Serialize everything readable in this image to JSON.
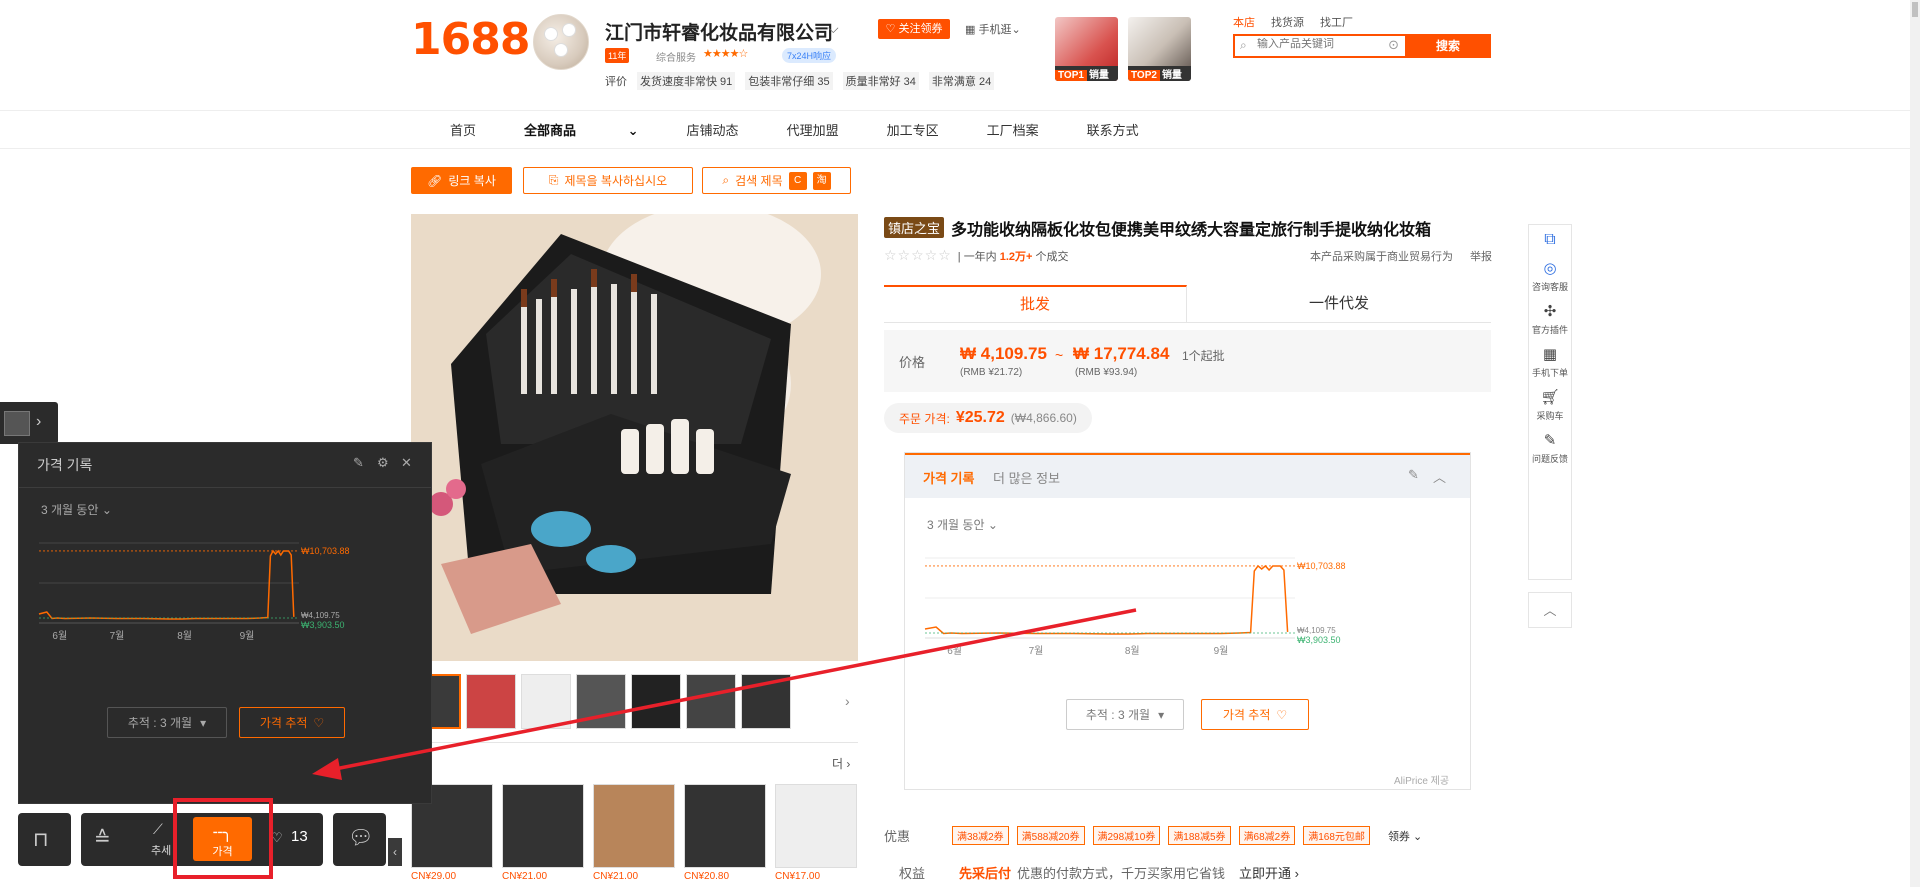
{
  "header": {
    "logo": "1688",
    "shop_name": "江门市轩睿化妆品有限公司",
    "follow_label": "关注领券",
    "mobile_label": "手机逛",
    "year_badge": "11年",
    "service_label": "综合服务",
    "service_stars": "★★★★☆",
    "support_badge": "7x24H响应",
    "rating_label": "评价",
    "ratings": [
      "发货速度非常快 91",
      "包装非常仔细 35",
      "质量非常好 34",
      "非常满意 24"
    ],
    "promos": [
      {
        "rank": "TOP1",
        "label": "销量"
      },
      {
        "rank": "TOP2",
        "label": "销量"
      }
    ],
    "search_tabs": [
      "本店",
      "找货源",
      "找工厂"
    ],
    "search_placeholder": "输入产品关键词",
    "search_button": "搜索"
  },
  "nav": {
    "items": [
      "首页",
      "全部商品",
      "店铺动态",
      "代理加盟",
      "加工专区",
      "工厂档案",
      "联系方式"
    ]
  },
  "extension_bar": {
    "copy_link": "링크 복사",
    "copy_title": "제목을 복사하십시오",
    "search_title": "검색 제목",
    "search_icon1": "C",
    "search_icon2": "淘"
  },
  "product": {
    "badge": "镇店之宝",
    "title": "多功能收纳隔板化妆包便携美甲纹绣大容量定旅行制手提收纳化妆箱",
    "stars": "☆☆☆☆☆",
    "sales_prefix": "一年内",
    "sales_value": "1.2万+",
    "sales_suffix": "个成交",
    "trade_note": "本产品采购属于商业贸易行为",
    "report": "举报",
    "tabs": [
      "批发",
      "一件代发"
    ],
    "price_label": "价格",
    "price_low": "₩ 4,109.75",
    "price_low_rmb": "(RMB ¥21.72)",
    "tilde": "~",
    "price_high": "₩ 17,774.84",
    "price_high_rmb": "(RMB ¥93.94)",
    "moq": "1个起批",
    "order_label": "주문 가격:",
    "order_price": "¥25.72",
    "order_krw": "(₩4,866.60)"
  },
  "thumbnails_count": 7,
  "more_label": "더",
  "related": [
    {
      "price": "CN¥29.00"
    },
    {
      "price": "CN¥21.00"
    },
    {
      "price": "CN¥21.00"
    },
    {
      "price": "CN¥20.80"
    },
    {
      "price": "CN¥17.00"
    }
  ],
  "price_history": {
    "tab_active": "가격 기록",
    "tab_other": "더 많은 정보",
    "range": "3 개월 동안",
    "track_label": "추적 : 3 개월",
    "alert_label": "가격 추적",
    "provider": "AliPrice 제공"
  },
  "dark_panel": {
    "title": "가격 기록",
    "range": "3 개월 동안",
    "track_label": "추적 : 3 개월",
    "alert_label": "가격 추적"
  },
  "chart_data": {
    "type": "line",
    "xticks": [
      "6월",
      "7월",
      "8월",
      "9월"
    ],
    "max_label": "₩10,703.88",
    "min_labels": [
      "₩4,109.75",
      "₩3,903.50"
    ],
    "series": [
      {
        "color": "#ff6a00",
        "points": [
          [
            0,
            4400
          ],
          [
            3,
            4600
          ],
          [
            5,
            3950
          ],
          [
            7,
            4000
          ],
          [
            10,
            3950
          ],
          [
            20,
            4000
          ],
          [
            30,
            3950
          ],
          [
            40,
            3950
          ],
          [
            50,
            3900
          ],
          [
            55,
            3900
          ],
          [
            60,
            3950
          ],
          [
            70,
            3950
          ],
          [
            80,
            3950
          ],
          [
            85,
            4000
          ],
          [
            88,
            4050
          ],
          [
            89,
            10200
          ],
          [
            90,
            10703.88
          ],
          [
            91,
            10400
          ],
          [
            92,
            10703.88
          ],
          [
            93,
            10300
          ],
          [
            94,
            10703.88
          ],
          [
            96,
            10703.88
          ],
          [
            97,
            10300
          ],
          [
            98,
            4109.75
          ]
        ]
      }
    ],
    "ylim": [
      3500,
      11500
    ]
  },
  "promotions": {
    "label": "优惠",
    "coupons": [
      "满38减2券",
      "满588减20券",
      "满298减10券",
      "满188减5券",
      "满68减2券",
      "满168元包邮"
    ],
    "claim": "领券"
  },
  "benefits": {
    "label": "权益",
    "title": "先采后付",
    "desc": "优惠的付款方式，千万买家用它省钱",
    "action": "立即开通"
  },
  "side_tools": [
    {
      "label": "咨询客服",
      "icon": "headset-icon"
    },
    {
      "label": "官方插件",
      "icon": "puzzle-icon"
    },
    {
      "label": "手机下单",
      "icon": "qr-icon"
    },
    {
      "label": "采购车",
      "icon": "cart-icon"
    },
    {
      "label": "问题反馈",
      "icon": "edit-icon"
    }
  ],
  "dock": {
    "trend_label": "추세",
    "price_label": "가격",
    "likes": "13"
  },
  "colors": {
    "brand": "#ff5000",
    "accent": "#ff6a00",
    "highlight": "#e8202a",
    "dark_panel": "#2b2b2b",
    "min_line": "#3cb371"
  }
}
